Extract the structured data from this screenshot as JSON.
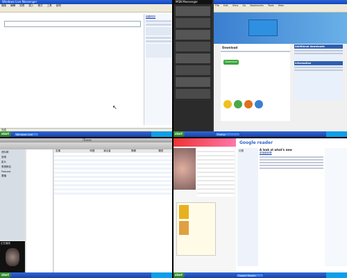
{
  "q1": {
    "title": "Windows Live Messenger",
    "menu": [
      "檔案",
      "編輯",
      "檢視",
      "插入",
      "格式",
      "工具",
      "說明"
    ],
    "status": "完成",
    "sidebar_heading": "相關資訊",
    "taskbar_item": "Windows Live"
  },
  "q2": {
    "chat_title": "MSN Messenger",
    "browser_menu": [
      "File",
      "Edit",
      "View",
      "Go",
      "Bookmarks",
      "Tools",
      "Help"
    ],
    "download_title": "Download",
    "download_button": "Download",
    "additional_title": "Additional downloads",
    "information_title": "Information",
    "taskbar_item": "Firefox"
  },
  "q3": {
    "title": "iTunes",
    "nav": [
      "資料庫",
      "音樂",
      "影片",
      "電視節目",
      "Podcast",
      "廣播"
    ],
    "columns": [
      "名稱",
      "時間",
      "演出者",
      "專輯",
      "類型"
    ],
    "artwork_label": "正在播放"
  },
  "q4": {
    "logo": "Google reader",
    "section_title": "A look at what's new",
    "feed_title": "部落格新聞",
    "sidebar_title": "訂閱",
    "taskbar_item": "Google Reader"
  }
}
